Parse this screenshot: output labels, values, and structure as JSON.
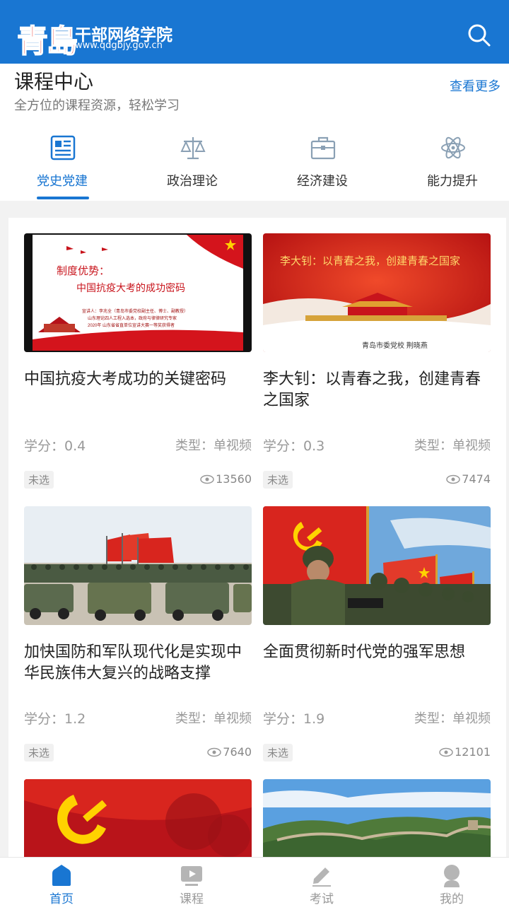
{
  "header": {
    "logo_calligraphy": "青島",
    "logo_title": "干部网络学院",
    "logo_url": "www.qdgbjy.gov.cn",
    "search_icon": "search-icon"
  },
  "section": {
    "title": "课程中心",
    "subtitle": "全方位的课程资源，轻松学习",
    "see_more": "查看更多"
  },
  "categories": [
    {
      "label": "党史党建",
      "icon": "document-icon",
      "active": true
    },
    {
      "label": "政治理论",
      "icon": "balance-scale-icon",
      "active": false
    },
    {
      "label": "经济建设",
      "icon": "briefcase-icon",
      "active": false
    },
    {
      "label": "能力提升",
      "icon": "atom-icon",
      "active": false
    }
  ],
  "courses": [
    {
      "title": "中国抗疫大考成功的关键密码",
      "credit": "学分：0.4",
      "type": "类型：单视频",
      "badge": "未选",
      "views": "13560",
      "thumb": {
        "heading": "制度优势：",
        "subheading": "中国抗疫大考的成功密码",
        "speaker_line1": "宣讲人：李兆全（青岛市委党校副主任、博士、副教授）",
        "speaker_line2": "山东理论四人工程入选本，政府与律律研究专家",
        "speaker_line3": "2020年 山东省省直单位宣讲大赛一等奖获得者"
      }
    },
    {
      "title": "李大钊：以青春之我，创建青春之国家",
      "credit": "学分：0.3",
      "type": "类型：单视频",
      "badge": "未选",
      "views": "7474",
      "thumb": {
        "heading": "李大钊：以青春之我，创建青春之国家",
        "footer": "青岛市委党校      荆晓燕"
      }
    },
    {
      "title": "加快国防和军队现代化是实现中华民族伟大复兴的战略支撑",
      "credit": "学分：1.2",
      "type": "类型：单视频",
      "badge": "未选",
      "views": "7640"
    },
    {
      "title": "全面贯彻新时代党的强军思想",
      "credit": "学分：1.9",
      "type": "类型：单视频",
      "badge": "未选",
      "views": "12101"
    }
  ],
  "tabbar": [
    {
      "label": "首页",
      "icon": "home-icon",
      "active": true
    },
    {
      "label": "课程",
      "icon": "play-icon",
      "active": false
    },
    {
      "label": "考试",
      "icon": "pencil-icon",
      "active": false
    },
    {
      "label": "我的",
      "icon": "user-icon",
      "active": false
    }
  ],
  "colors": {
    "primary": "#1976d2",
    "logo_red": "#e2231a"
  }
}
